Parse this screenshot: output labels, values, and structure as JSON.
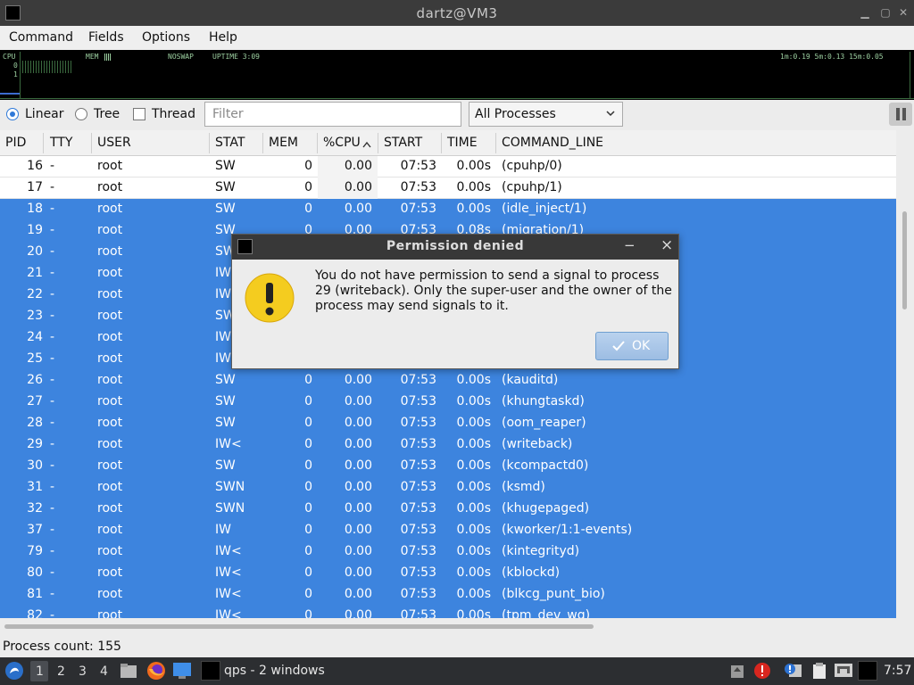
{
  "window": {
    "title": "dartz@VM3"
  },
  "menu": [
    "Command",
    "Fields",
    "Options",
    "Help"
  ],
  "monitor": {
    "cpu_label": "CPU",
    "mem_label": "MEM",
    "noswap": "NOSWAP",
    "uptime": "UPTIME 3:09",
    "load": "1m:0.19 5m:0.13 15m:0.05",
    "axis_0": "0",
    "axis_1": "1"
  },
  "toolbar": {
    "linear": "Linear",
    "tree": "Tree",
    "thread": "Thread",
    "filter_placeholder": "Filter",
    "process_filter": "All Processes",
    "view_mode": "linear",
    "thread_checked": false
  },
  "columns": [
    "PID",
    "TTY",
    "USER",
    "STAT",
    "MEM",
    "%CPU",
    "START",
    "TIME",
    "COMMAND_LINE"
  ],
  "rows": [
    {
      "pid": "16",
      "tty": "-",
      "user": "root",
      "stat": "SW",
      "mem": "0",
      "cpu": "0.00",
      "start": "07:53",
      "time": "0.00s",
      "cmd": "(cpuhp/0)",
      "selected": false
    },
    {
      "pid": "17",
      "tty": "-",
      "user": "root",
      "stat": "SW",
      "mem": "0",
      "cpu": "0.00",
      "start": "07:53",
      "time": "0.00s",
      "cmd": "(cpuhp/1)",
      "selected": false
    },
    {
      "pid": "18",
      "tty": "-",
      "user": "root",
      "stat": "SW",
      "mem": "0",
      "cpu": "0.00",
      "start": "07:53",
      "time": "0.00s",
      "cmd": "(idle_inject/1)",
      "selected": true
    },
    {
      "pid": "19",
      "tty": "-",
      "user": "root",
      "stat": "SW",
      "mem": "0",
      "cpu": "0.00",
      "start": "07:53",
      "time": "0.08s",
      "cmd": "(migration/1)",
      "selected": true
    },
    {
      "pid": "20",
      "tty": "-",
      "user": "root",
      "stat": "SW",
      "mem": "",
      "cpu": "",
      "start": "",
      "time": "",
      "cmd": "",
      "selected": true
    },
    {
      "pid": "21",
      "tty": "-",
      "user": "root",
      "stat": "IW",
      "mem": "",
      "cpu": "",
      "start": "",
      "time": "",
      "cmd": "",
      "selected": true
    },
    {
      "pid": "22",
      "tty": "-",
      "user": "root",
      "stat": "IW",
      "mem": "",
      "cpu": "",
      "start": "",
      "time": "",
      "cmd": ")",
      "selected": true
    },
    {
      "pid": "23",
      "tty": "-",
      "user": "root",
      "stat": "SW",
      "mem": "",
      "cpu": "",
      "start": "",
      "time": "",
      "cmd": "",
      "selected": true
    },
    {
      "pid": "24",
      "tty": "-",
      "user": "root",
      "stat": "IW",
      "mem": "",
      "cpu": "",
      "start": "",
      "time": "",
      "cmd": "",
      "selected": true
    },
    {
      "pid": "25",
      "tty": "-",
      "user": "root",
      "stat": "IW",
      "mem": "",
      "cpu": "",
      "start": "",
      "time": "",
      "cmd": "",
      "selected": true
    },
    {
      "pid": "26",
      "tty": "-",
      "user": "root",
      "stat": "SW",
      "mem": "0",
      "cpu": "0.00",
      "start": "07:53",
      "time": "0.00s",
      "cmd": "(kauditd)",
      "selected": true
    },
    {
      "pid": "27",
      "tty": "-",
      "user": "root",
      "stat": "SW",
      "mem": "0",
      "cpu": "0.00",
      "start": "07:53",
      "time": "0.00s",
      "cmd": "(khungtaskd)",
      "selected": true
    },
    {
      "pid": "28",
      "tty": "-",
      "user": "root",
      "stat": "SW",
      "mem": "0",
      "cpu": "0.00",
      "start": "07:53",
      "time": "0.00s",
      "cmd": "(oom_reaper)",
      "selected": true
    },
    {
      "pid": "29",
      "tty": "-",
      "user": "root",
      "stat": "IW<",
      "mem": "0",
      "cpu": "0.00",
      "start": "07:53",
      "time": "0.00s",
      "cmd": "(writeback)",
      "selected": true
    },
    {
      "pid": "30",
      "tty": "-",
      "user": "root",
      "stat": "SW",
      "mem": "0",
      "cpu": "0.00",
      "start": "07:53",
      "time": "0.00s",
      "cmd": "(kcompactd0)",
      "selected": true
    },
    {
      "pid": "31",
      "tty": "-",
      "user": "root",
      "stat": "SWN",
      "mem": "0",
      "cpu": "0.00",
      "start": "07:53",
      "time": "0.00s",
      "cmd": "(ksmd)",
      "selected": true
    },
    {
      "pid": "32",
      "tty": "-",
      "user": "root",
      "stat": "SWN",
      "mem": "0",
      "cpu": "0.00",
      "start": "07:53",
      "time": "0.00s",
      "cmd": "(khugepaged)",
      "selected": true
    },
    {
      "pid": "37",
      "tty": "-",
      "user": "root",
      "stat": "IW",
      "mem": "0",
      "cpu": "0.00",
      "start": "07:53",
      "time": "0.00s",
      "cmd": "(kworker/1:1-events)",
      "selected": true
    },
    {
      "pid": "79",
      "tty": "-",
      "user": "root",
      "stat": "IW<",
      "mem": "0",
      "cpu": "0.00",
      "start": "07:53",
      "time": "0.00s",
      "cmd": "(kintegrityd)",
      "selected": true
    },
    {
      "pid": "80",
      "tty": "-",
      "user": "root",
      "stat": "IW<",
      "mem": "0",
      "cpu": "0.00",
      "start": "07:53",
      "time": "0.00s",
      "cmd": "(kblockd)",
      "selected": true
    },
    {
      "pid": "81",
      "tty": "-",
      "user": "root",
      "stat": "IW<",
      "mem": "0",
      "cpu": "0.00",
      "start": "07:53",
      "time": "0.00s",
      "cmd": "(blkcg_punt_bio)",
      "selected": true
    },
    {
      "pid": "82",
      "tty": "-",
      "user": "root",
      "stat": "IW<",
      "mem": "0",
      "cpu": "0.00",
      "start": "07:53",
      "time": "0.00s",
      "cmd": "(tpm_dev_wq)",
      "selected": true
    }
  ],
  "status": {
    "process_count": "Process count: 155"
  },
  "taskbar": {
    "workspaces": [
      "1",
      "2",
      "3",
      "4"
    ],
    "active_workspace": "1",
    "task_label": "qps - 2 windows",
    "clock": "7:57"
  },
  "dialog": {
    "title": "Permission denied",
    "message": "You do not have permission to send a signal to process 29 (writeback). Only the super-user and the owner of the process may send signals to it.",
    "ok_label": "OK",
    "minimize": "−",
    "close": "×"
  },
  "colors": {
    "selection": "#3d84de",
    "warning": "#f4cc1f",
    "ok_button": "#a9c7e8"
  }
}
